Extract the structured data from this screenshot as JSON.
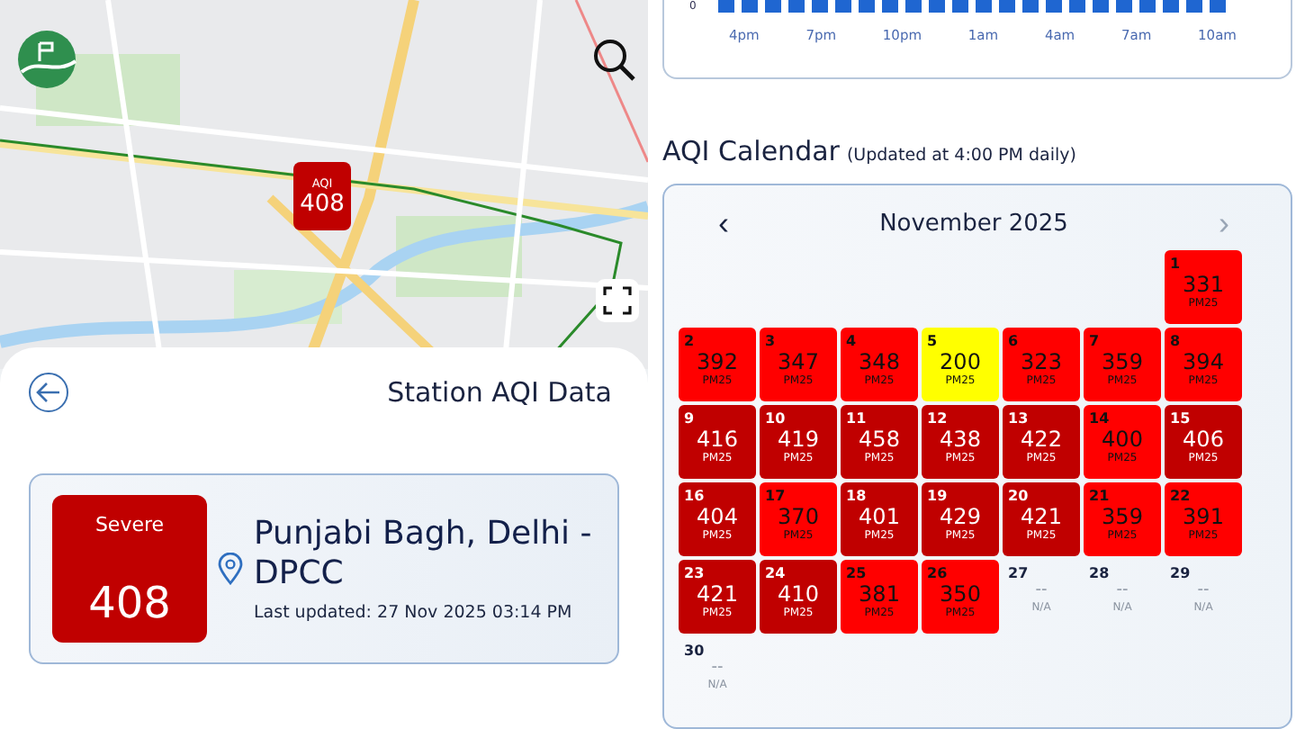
{
  "map": {
    "kind": "picture",
    "marker": {
      "label": "AQI",
      "value": "408"
    }
  },
  "station": {
    "title": "Station AQI Data",
    "category": "Severe",
    "aqi": "408",
    "name": "Punjabi Bagh, Delhi - DPCC",
    "updated": "Last updated: 27 Nov 2025 03:14 PM"
  },
  "hourly_chart": {
    "y_tick": "0",
    "x_labels": [
      "4pm",
      "7pm",
      "10pm",
      "1am",
      "4am",
      "7am",
      "10am"
    ]
  },
  "calendar": {
    "title": "AQI Calendar",
    "note": "(Updated at 4:00 PM daily)",
    "month": "November 2025",
    "prev": "‹",
    "next": "›",
    "next_disabled": true,
    "days": [
      {
        "kind": "blank"
      },
      {
        "kind": "blank"
      },
      {
        "kind": "blank"
      },
      {
        "kind": "blank"
      },
      {
        "kind": "blank"
      },
      {
        "kind": "blank"
      },
      {
        "kind": "day",
        "day": "1",
        "value": "331",
        "unit": "PM25",
        "color": "#ff0000"
      },
      {
        "kind": "day",
        "day": "2",
        "value": "392",
        "unit": "PM25",
        "color": "#ff0000"
      },
      {
        "kind": "day",
        "day": "3",
        "value": "347",
        "unit": "PM25",
        "color": "#ff0000"
      },
      {
        "kind": "day",
        "day": "4",
        "value": "348",
        "unit": "PM25",
        "color": "#ff0000"
      },
      {
        "kind": "day",
        "day": "5",
        "value": "200",
        "unit": "PM25",
        "color": "#ffff00"
      },
      {
        "kind": "day",
        "day": "6",
        "value": "323",
        "unit": "PM25",
        "color": "#ff0000"
      },
      {
        "kind": "day",
        "day": "7",
        "value": "359",
        "unit": "PM25",
        "color": "#ff0000"
      },
      {
        "kind": "day",
        "day": "8",
        "value": "394",
        "unit": "PM25",
        "color": "#ff0000"
      },
      {
        "kind": "day",
        "day": "9",
        "value": "416",
        "unit": "PM25",
        "color": "#c00000"
      },
      {
        "kind": "day",
        "day": "10",
        "value": "419",
        "unit": "PM25",
        "color": "#c00000"
      },
      {
        "kind": "day",
        "day": "11",
        "value": "458",
        "unit": "PM25",
        "color": "#c00000"
      },
      {
        "kind": "day",
        "day": "12",
        "value": "438",
        "unit": "PM25",
        "color": "#c00000"
      },
      {
        "kind": "day",
        "day": "13",
        "value": "422",
        "unit": "PM25",
        "color": "#c00000"
      },
      {
        "kind": "day",
        "day": "14",
        "value": "400",
        "unit": "PM25",
        "color": "#ff0000"
      },
      {
        "kind": "day",
        "day": "15",
        "value": "406",
        "unit": "PM25",
        "color": "#c00000"
      },
      {
        "kind": "day",
        "day": "16",
        "value": "404",
        "unit": "PM25",
        "color": "#c00000"
      },
      {
        "kind": "day",
        "day": "17",
        "value": "370",
        "unit": "PM25",
        "color": "#ff0000"
      },
      {
        "kind": "day",
        "day": "18",
        "value": "401",
        "unit": "PM25",
        "color": "#c00000"
      },
      {
        "kind": "day",
        "day": "19",
        "value": "429",
        "unit": "PM25",
        "color": "#c00000"
      },
      {
        "kind": "day",
        "day": "20",
        "value": "421",
        "unit": "PM25",
        "color": "#c00000"
      },
      {
        "kind": "day",
        "day": "21",
        "value": "359",
        "unit": "PM25",
        "color": "#ff0000"
      },
      {
        "kind": "day",
        "day": "22",
        "value": "391",
        "unit": "PM25",
        "color": "#ff0000"
      },
      {
        "kind": "day",
        "day": "23",
        "value": "421",
        "unit": "PM25",
        "color": "#c00000"
      },
      {
        "kind": "day",
        "day": "24",
        "value": "410",
        "unit": "PM25",
        "color": "#c00000"
      },
      {
        "kind": "day",
        "day": "25",
        "value": "381",
        "unit": "PM25",
        "color": "#ff0000"
      },
      {
        "kind": "day",
        "day": "26",
        "value": "350",
        "unit": "PM25",
        "color": "#ff0000"
      },
      {
        "kind": "empty",
        "day": "27",
        "value": "--",
        "unit": "N/A"
      },
      {
        "kind": "empty",
        "day": "28",
        "value": "--",
        "unit": "N/A"
      },
      {
        "kind": "empty",
        "day": "29",
        "value": "--",
        "unit": "N/A"
      },
      {
        "kind": "empty",
        "day": "30",
        "value": "--",
        "unit": "N/A"
      }
    ]
  }
}
